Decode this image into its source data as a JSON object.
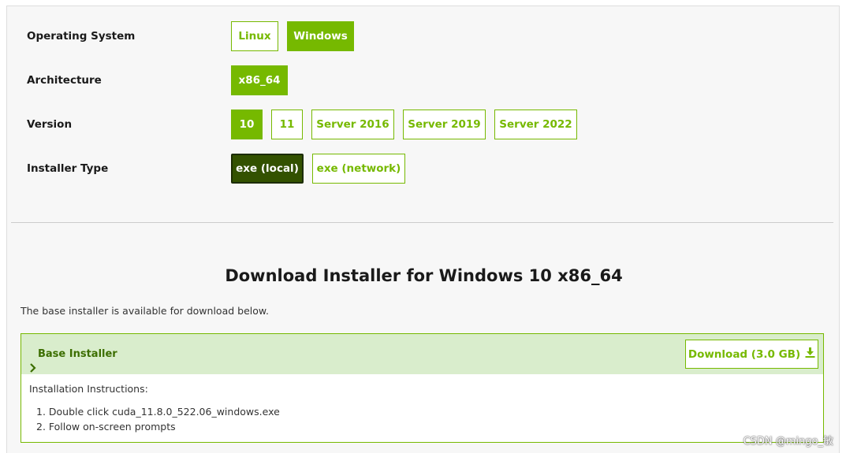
{
  "selector": {
    "rows": [
      {
        "label": "Operating System",
        "options": [
          "Linux",
          "Windows"
        ]
      },
      {
        "label": "Architecture",
        "options": [
          "x86_64"
        ]
      },
      {
        "label": "Version",
        "options": [
          "10",
          "11",
          "Server 2016",
          "Server 2019",
          "Server 2022"
        ]
      },
      {
        "label": "Installer Type",
        "options": [
          "exe (local)",
          "exe (network)"
        ]
      }
    ]
  },
  "download": {
    "heading": "Download Installer for Windows 10 x86_64",
    "note": "The base installer is available for download below.",
    "installer_title": "Base Installer",
    "button_label": "Download (3.0 GB)",
    "instructions_label": "Installation Instructions:",
    "steps": [
      "1. Double click cuda_11.8.0_522.06_windows.exe",
      "2. Follow on-screen prompts"
    ]
  },
  "watermark": "CSDN @mingo_敏",
  "colors": {
    "accent": "#76b900",
    "accent_dark": "#335100",
    "header_bg": "#d9edcc"
  },
  "icons": {
    "chevron": "chevron-right-icon",
    "download": "download-icon"
  }
}
